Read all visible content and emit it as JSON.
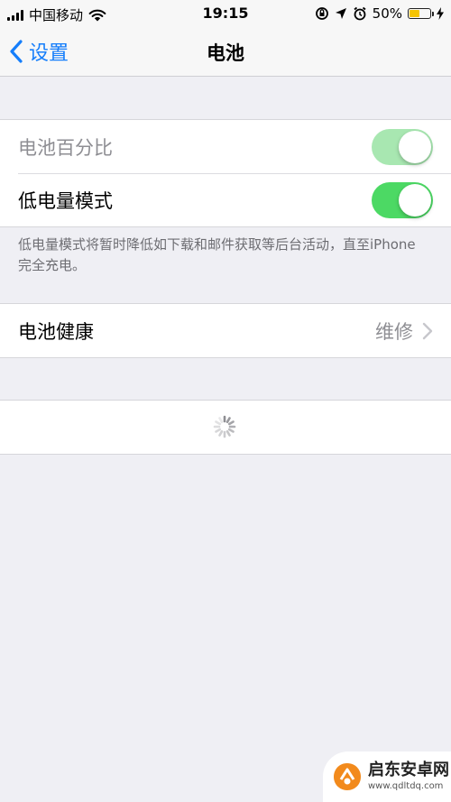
{
  "status_bar": {
    "carrier": "中国移动",
    "time": "19:15",
    "battery_percent": "50%",
    "battery_level": 0.5,
    "icons": [
      "signal-icon",
      "wifi-icon",
      "orientation-lock-icon",
      "location-icon",
      "alarm-icon",
      "battery-icon",
      "charging-icon"
    ]
  },
  "nav": {
    "back_label": "设置",
    "title": "电池"
  },
  "settings": {
    "battery_percentage": {
      "label": "电池百分比",
      "enabled": true,
      "disabled_appearance": true
    },
    "low_power_mode": {
      "label": "低电量模式",
      "enabled": true
    },
    "low_power_footnote": "低电量模式将暂时降低如下载和邮件获取等后台活动，直至iPhone 完全充电。",
    "battery_health": {
      "label": "电池健康",
      "value": "维修"
    }
  },
  "watermark": {
    "name": "启东安卓网",
    "url": "www.qdltdq.com"
  },
  "colors": {
    "accent": "#157efb",
    "switch_on": "#4cd964",
    "background": "#efeff4",
    "battery_fill": "#f5c400"
  }
}
